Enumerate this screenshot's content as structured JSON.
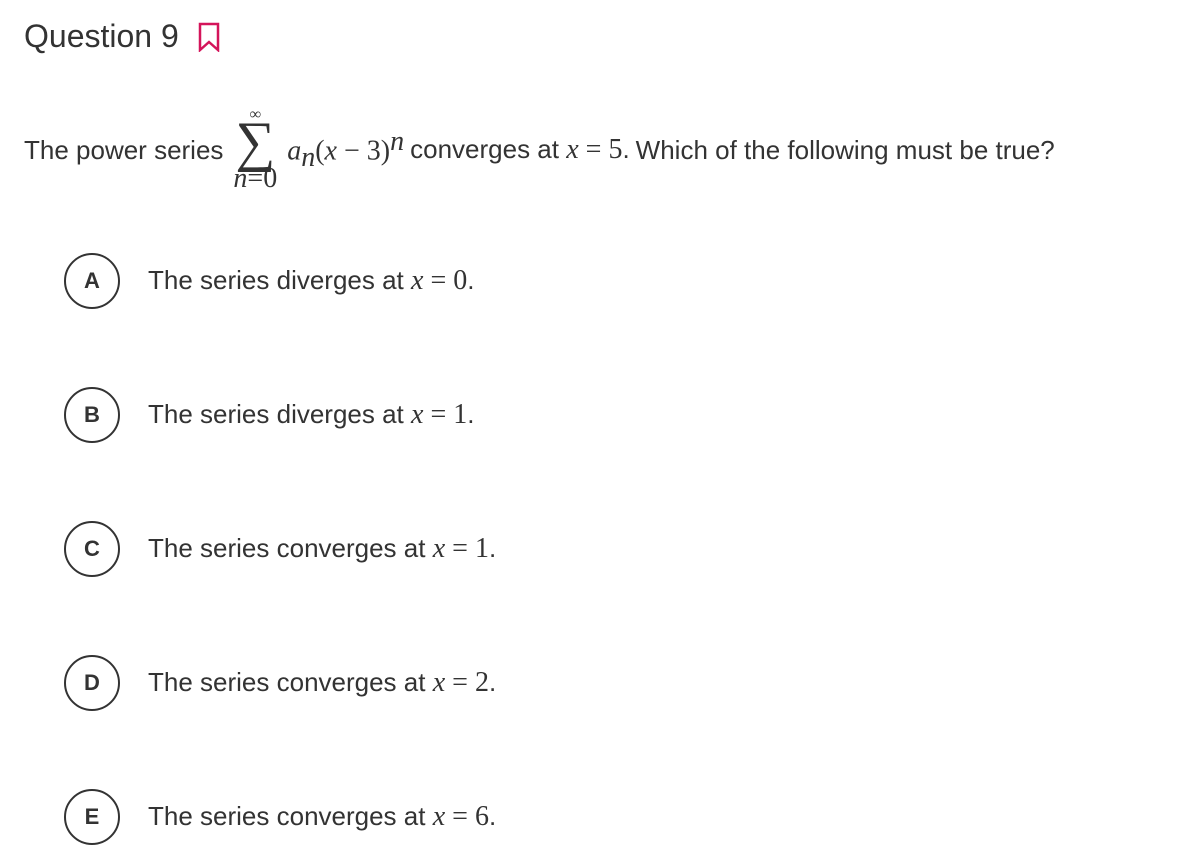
{
  "header": {
    "title": "Question 9"
  },
  "stem": {
    "prefix": "The power series",
    "sigma_upper": "∞",
    "sigma_lower_lhs": "n",
    "sigma_lower_eq": "=",
    "sigma_lower_rhs": "0",
    "term_a": "a",
    "term_a_sub": "n",
    "term_open": "(",
    "term_x": "x",
    "term_minus": " − ",
    "term_const": "3",
    "term_close": ")",
    "term_exp": "n",
    "mid": " converges at ",
    "x_var": "x",
    "eq": " = ",
    "x_val": "5",
    "period": ". ",
    "suffix": "Which of the following must be true?"
  },
  "answers": [
    {
      "letter": "A",
      "prefix": "The series diverges at ",
      "x": "x",
      "eq": " = ",
      "val": "0",
      "period": "."
    },
    {
      "letter": "B",
      "prefix": "The series diverges at ",
      "x": "x",
      "eq": " = ",
      "val": "1",
      "period": "."
    },
    {
      "letter": "C",
      "prefix": "The series converges at ",
      "x": "x",
      "eq": " = ",
      "val": "1",
      "period": "."
    },
    {
      "letter": "D",
      "prefix": "The series converges at ",
      "x": "x",
      "eq": " = ",
      "val": "2",
      "period": "."
    },
    {
      "letter": "E",
      "prefix": "The series converges at ",
      "x": "x",
      "eq": " = ",
      "val": "6",
      "period": "."
    }
  ]
}
